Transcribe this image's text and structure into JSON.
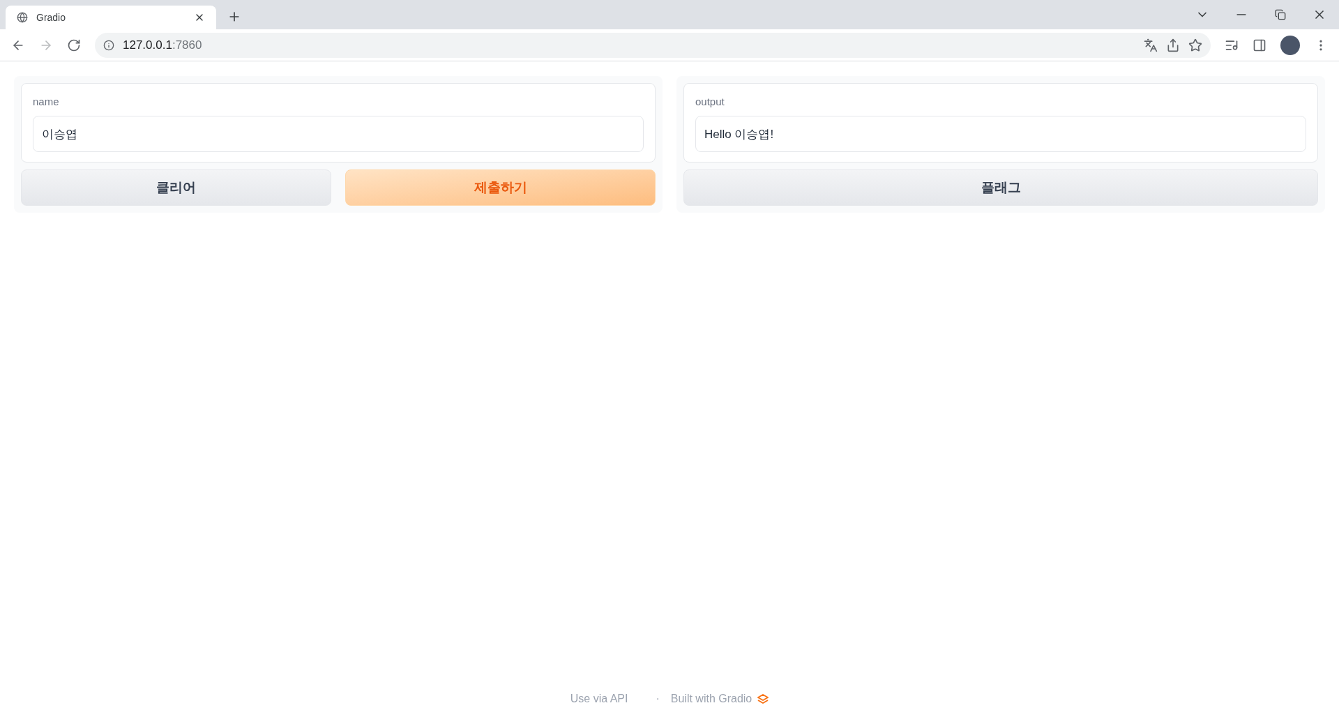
{
  "browser": {
    "tab": {
      "title": "Gradio"
    },
    "address": {
      "host": "127.0.0.1",
      "port": ":7860"
    }
  },
  "input_panel": {
    "field": {
      "label": "name",
      "value": "이승엽"
    },
    "buttons": [
      {
        "label": "클리어",
        "kind": "secondary"
      },
      {
        "label": "제출하기",
        "kind": "primary"
      }
    ]
  },
  "output_panel": {
    "field": {
      "label": "output",
      "value": "Hello 이승엽!"
    },
    "buttons": [
      {
        "label": "플래그",
        "kind": "secondary"
      }
    ]
  },
  "footer": {
    "api_link": "Use via API",
    "separator": "·",
    "built_with": "Built with Gradio"
  }
}
